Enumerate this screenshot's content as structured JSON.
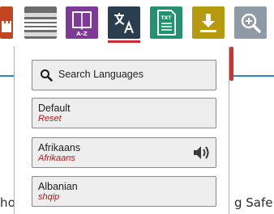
{
  "toolbar": {
    "buttons": [
      {
        "name": "partial-left",
        "icon": "castle-icon",
        "color": "#c3451f"
      },
      {
        "name": "screen-mask",
        "icon": "screen-mask-icon",
        "color": "#6d6d6d"
      },
      {
        "name": "picture-dictionary",
        "icon": "book-az-icon",
        "color": "#7d3a98",
        "text": "A-Z"
      },
      {
        "name": "translate",
        "icon": "translate-icon",
        "color": "#2b3e50",
        "active_underline": "#c92a3a"
      },
      {
        "name": "text-file",
        "icon": "txt-file-icon",
        "color": "#23926f",
        "text": "TXT"
      },
      {
        "name": "download",
        "icon": "download-icon",
        "color": "#b59a0e"
      },
      {
        "name": "zoom",
        "icon": "zoom-in-icon",
        "color": "#8e9aa6"
      }
    ]
  },
  "background": {
    "left_fragment": "ho",
    "right_fragment": "g Safe"
  },
  "languages_panel": {
    "search_label": "Search Languages",
    "items": [
      {
        "name": "Default",
        "native": "Reset",
        "has_audio": false
      },
      {
        "name": "Afrikaans",
        "native": "Afrikaans",
        "has_audio": true
      },
      {
        "name": "Albanian",
        "native": "shqip",
        "has_audio": false
      }
    ],
    "accent_color": "#b2181d"
  }
}
